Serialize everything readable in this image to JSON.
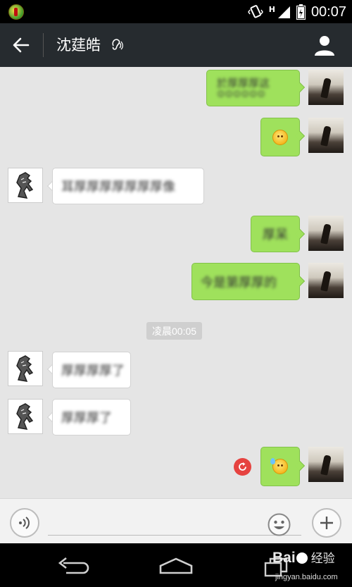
{
  "status_bar": {
    "network_type": "H",
    "time": "00:07"
  },
  "header": {
    "title": "沈莛皓",
    "icons": [
      "back-arrow-icon",
      "earpiece-mode-icon",
      "contact-profile-icon"
    ]
  },
  "messages": [
    {
      "side": "out",
      "text": "於厚厚厚这",
      "emoji_row": "😊😊😊😊😊😊",
      "blurred": true
    },
    {
      "side": "out",
      "emoji": "smile",
      "blurred": false
    },
    {
      "side": "in",
      "text": "耳厚厚厚厚厚厚厚像",
      "blurred": true
    },
    {
      "side": "out",
      "text": "厚呆",
      "blurred": true
    },
    {
      "side": "out",
      "text": "今是第厚厚的",
      "blurred": true
    },
    {
      "side": "in",
      "text": "厚厚厚厚了",
      "blurred": true
    },
    {
      "side": "in",
      "text": "厚厚厚了",
      "blurred": true
    },
    {
      "side": "out",
      "emoji": "sweat",
      "failed": true
    }
  ],
  "timestamp": "凌晨00:05",
  "input_bar": {
    "input_value": "",
    "icons": [
      "voice-icon",
      "emoji-icon",
      "plus-icon"
    ]
  },
  "watermark": {
    "brand": "Bai",
    "brand_cn": "经验",
    "url": "jingyan.baidu.com"
  },
  "colors": {
    "header_bg": "#262b2f",
    "chat_bg": "#e5e5e5",
    "bubble_out": "#9fe15c",
    "bubble_in": "#ffffff",
    "resend": "#e64340"
  }
}
